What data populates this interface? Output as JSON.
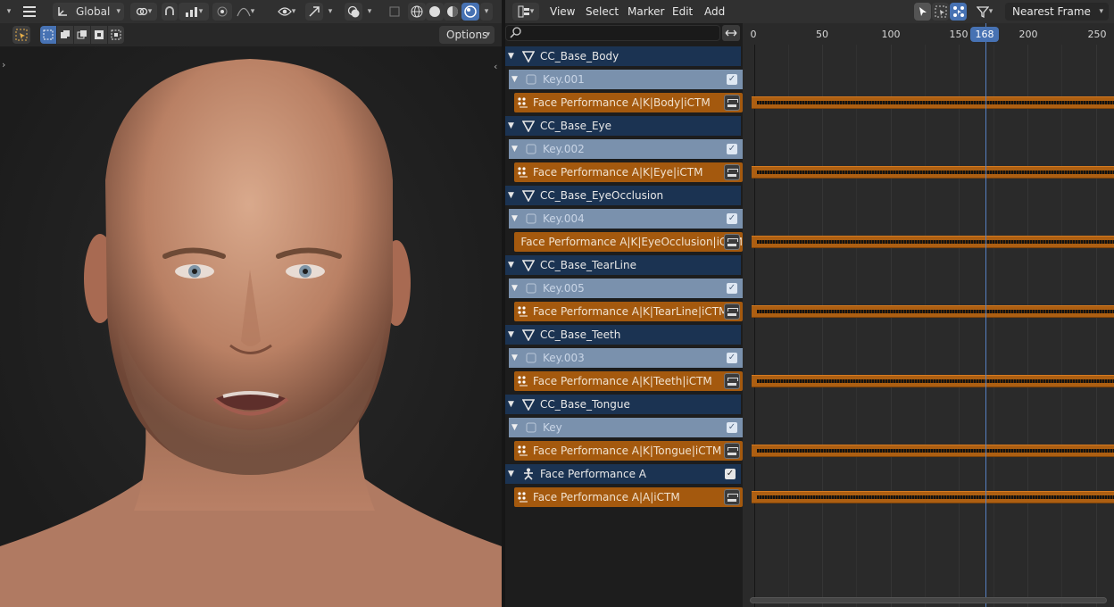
{
  "viewport": {
    "transform_orientation": "Global",
    "options_label": "Options"
  },
  "nla": {
    "menu": [
      "View",
      "Select",
      "Marker",
      "Edit",
      "Add"
    ],
    "snapping": "Nearest Frame",
    "search_placeholder": "",
    "ruler_ticks": [
      "0",
      "50",
      "100",
      "150",
      "200",
      "250"
    ],
    "current_frame": "168",
    "channels": [
      {
        "type": "object",
        "label": "CC_Base_Body"
      },
      {
        "type": "key",
        "label": "Key.001"
      },
      {
        "type": "track",
        "label": "Face Performance A|K|Body|iCTM"
      },
      {
        "type": "object",
        "label": "CC_Base_Eye"
      },
      {
        "type": "key",
        "label": "Key.002"
      },
      {
        "type": "track",
        "label": "Face Performance A|K|Eye|iCTM"
      },
      {
        "type": "object",
        "label": "CC_Base_EyeOcclusion"
      },
      {
        "type": "key",
        "label": "Key.004"
      },
      {
        "type": "track",
        "label": "Face Performance A|K|EyeOcclusion|iCTM"
      },
      {
        "type": "object",
        "label": "CC_Base_TearLine"
      },
      {
        "type": "key",
        "label": "Key.005"
      },
      {
        "type": "track",
        "label": "Face Performance A|K|TearLine|iCTM"
      },
      {
        "type": "object",
        "label": "CC_Base_Teeth"
      },
      {
        "type": "key",
        "label": "Key.003"
      },
      {
        "type": "track",
        "label": "Face Performance A|K|Teeth|iCTM"
      },
      {
        "type": "object",
        "label": "CC_Base_Tongue"
      },
      {
        "type": "key",
        "label": "Key"
      },
      {
        "type": "track",
        "label": "Face Performance A|K|Tongue|iCTM"
      },
      {
        "type": "armature",
        "label": "Face Performance A"
      },
      {
        "type": "track",
        "label": "Face Performance A|A|iCTM"
      }
    ]
  },
  "colors": {
    "object_row": "#1b3352",
    "key_row": "#7a91ad",
    "action_track": "#a4590e",
    "playhead": "#4772b3"
  }
}
